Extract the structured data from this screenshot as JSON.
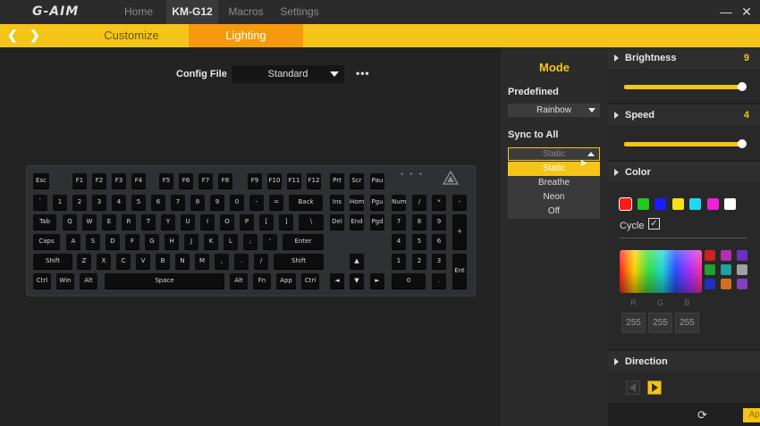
{
  "header": {
    "logo": "G-AIM",
    "tabs": [
      "Home",
      "KM-G12",
      "Macros",
      "Settings"
    ],
    "active_tab": "KM-G12"
  },
  "subnav": {
    "tabs": [
      "Customize",
      "Lighting"
    ],
    "active_tab": "Lighting"
  },
  "config": {
    "label": "Config File",
    "value": "Standard"
  },
  "keyboard": {
    "rows": [
      [
        "Esc",
        "F1",
        "F2",
        "F3",
        "F4",
        "F5",
        "F6",
        "F7",
        "F8",
        "F9",
        "F10",
        "F11",
        "F12",
        "Prt",
        "Scr",
        "Pau"
      ],
      [
        "`",
        "1",
        "2",
        "3",
        "4",
        "5",
        "6",
        "7",
        "8",
        "9",
        "0",
        "-",
        "=",
        "Back",
        "Ins",
        "Hom",
        "Pgu",
        "Num",
        "/",
        "*",
        "-"
      ],
      [
        "Tab",
        "Q",
        "W",
        "E",
        "R",
        "T",
        "Y",
        "U",
        "I",
        "O",
        "P",
        "[",
        "]",
        "\\",
        "Del",
        "End",
        "Pgd",
        "7",
        "8",
        "9",
        "+"
      ],
      [
        "Caps",
        "A",
        "S",
        "D",
        "F",
        "G",
        "H",
        "J",
        "K",
        "L",
        ";",
        "'",
        "Enter",
        "4",
        "5",
        "6"
      ],
      [
        "Shift",
        "Z",
        "X",
        "C",
        "V",
        "B",
        "N",
        "M",
        ",",
        ".",
        "/",
        "Shift",
        "▲",
        "1",
        "2",
        "3",
        "Ent"
      ],
      [
        "Ctrl",
        "Win",
        "Alt",
        "Space",
        "Alt",
        "Fn",
        "App",
        "Ctrl",
        "◄",
        "▼",
        "►",
        "0",
        "."
      ]
    ]
  },
  "mode": {
    "title": "Mode",
    "predefined_label": "Predefined",
    "predefined_value": "Rainbow",
    "sync_label": "Sync to All",
    "sync_value": "Static",
    "options": [
      "Static",
      "Breathe",
      "Neon",
      "Off"
    ],
    "selected_option": "Static"
  },
  "brightness": {
    "label": "Brightness",
    "value": "9",
    "fraction": 1.0
  },
  "speed": {
    "label": "Speed",
    "value": "4",
    "fraction": 1.0
  },
  "color": {
    "label": "Color",
    "swatches": [
      "#ff1a1a",
      "#22c822",
      "#1a1aff",
      "#f4e018",
      "#22d8f0",
      "#f020d8",
      "#ffffff"
    ],
    "selected": "#ff1a1a",
    "cycle_label": "Cycle",
    "cycle_checked": true,
    "mini_swatches": [
      "#d02020",
      "#b030b0",
      "#6a30c0",
      "#20a030",
      "#20a0a0",
      "#a0a0a0",
      "#2030c0",
      "#d07020",
      "#8040c0"
    ],
    "rgb_labels": [
      "R",
      "G",
      "B"
    ],
    "rgb_values": [
      "255",
      "255",
      "255"
    ]
  },
  "direction": {
    "label": "Direction"
  },
  "footer": {
    "apply_label": "Apply"
  },
  "colors": {
    "accent": "#f4c518",
    "accent_orange": "#f59a0c"
  }
}
